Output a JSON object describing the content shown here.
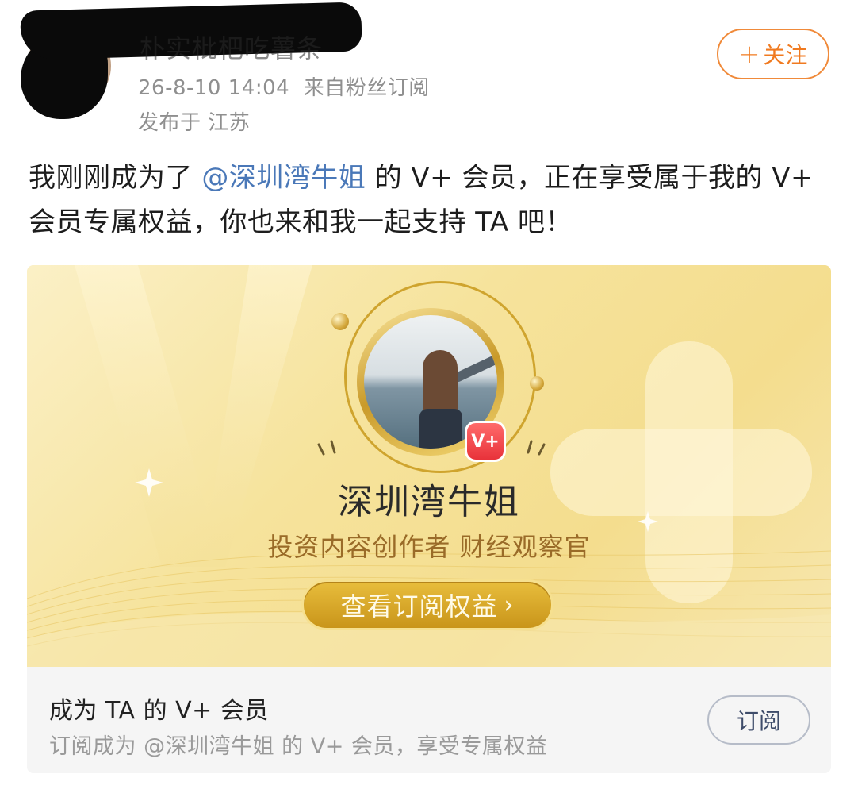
{
  "header": {
    "username": "朴实枇杷吃薯条",
    "timestamp": "26-8-10 14:04",
    "source": "来自粉丝订阅",
    "location": "发布于 江苏",
    "follow_plus": "+",
    "follow_label": "关注"
  },
  "post": {
    "text_before": "我刚刚成为了 ",
    "mention": "@深圳湾牛姐",
    "text_after": " 的 V+ 会员，正在享受属于我的 V+ 会员专属权益，你也来和我一起支持 TA 吧！"
  },
  "card": {
    "badge": "V+",
    "creator_name": "深圳湾牛姐",
    "creator_title": "投资内容创作者 财经观察官",
    "view_button": "查看订阅权益",
    "view_chevron": "›",
    "footer_title": "成为 TA 的 V+ 会员",
    "footer_subtitle": "订阅成为 @深圳湾牛姐 的 V+ 会员，享受专属权益",
    "subscribe_button": "订阅"
  },
  "colors": {
    "accent_orange": "#f07a20",
    "mention_blue": "#4a78b8",
    "gold": "#c9951a"
  }
}
